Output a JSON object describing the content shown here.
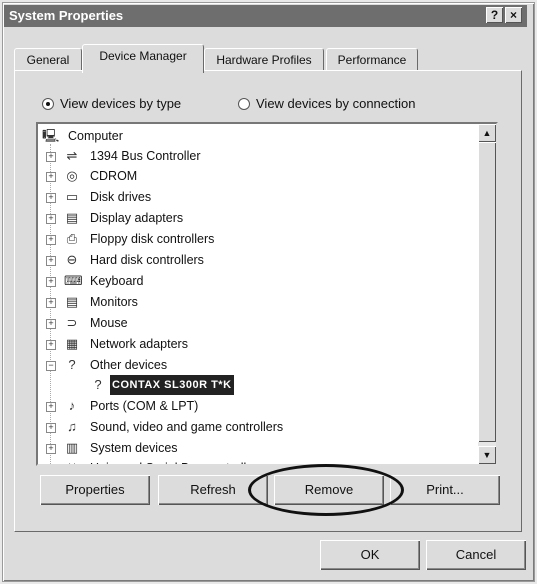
{
  "window": {
    "title": "System Properties",
    "help_button": "?",
    "close_button": "×"
  },
  "tabs": [
    "General",
    "Device Manager",
    "Hardware Profiles",
    "Performance"
  ],
  "view_options": {
    "by_type": "View devices by type",
    "by_connection": "View devices by connection",
    "selected": "by_type"
  },
  "tree": {
    "root": "Computer",
    "items": [
      {
        "label": "1394 Bus Controller",
        "icon": "bus-icon",
        "expander": "+"
      },
      {
        "label": "CDROM",
        "icon": "cdrom-icon",
        "expander": "+"
      },
      {
        "label": "Disk drives",
        "icon": "disk-icon",
        "expander": "+"
      },
      {
        "label": "Display adapters",
        "icon": "display-icon",
        "expander": "+"
      },
      {
        "label": "Floppy disk controllers",
        "icon": "floppy-icon",
        "expander": "+"
      },
      {
        "label": "Hard disk controllers",
        "icon": "hdd-icon",
        "expander": "+"
      },
      {
        "label": "Keyboard",
        "icon": "keyboard-icon",
        "expander": "+"
      },
      {
        "label": "Monitors",
        "icon": "monitor-icon",
        "expander": "+"
      },
      {
        "label": "Mouse",
        "icon": "mouse-icon",
        "expander": "+"
      },
      {
        "label": "Network adapters",
        "icon": "network-icon",
        "expander": "+"
      },
      {
        "label": "Other devices",
        "icon": "question-icon",
        "expander": "−"
      },
      {
        "label": "CONTAX SL300R T*K",
        "icon": "question-icon",
        "expander": "",
        "child": true,
        "selected": true
      },
      {
        "label": "Ports (COM & LPT)",
        "icon": "port-icon",
        "expander": "+"
      },
      {
        "label": "Sound, video and game controllers",
        "icon": "sound-icon",
        "expander": "+"
      },
      {
        "label": "System devices",
        "icon": "system-icon",
        "expander": "+"
      },
      {
        "label": "Universal Serial Bus controllers",
        "icon": "usb-icon",
        "expander": "+"
      }
    ]
  },
  "buttons": {
    "properties": "Properties",
    "refresh": "Refresh",
    "remove": "Remove",
    "print": "Print...",
    "ok": "OK",
    "cancel": "Cancel"
  }
}
